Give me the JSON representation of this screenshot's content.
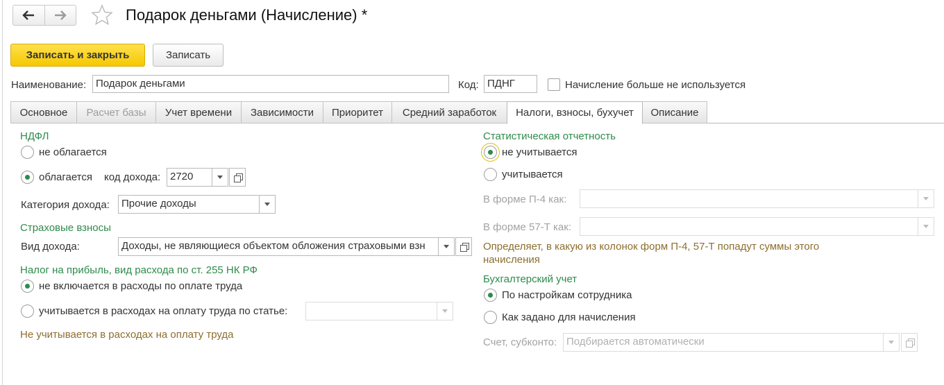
{
  "window": {
    "title": "Подарок деньгами (Начисление) *",
    "back_icon": "arrow-left-icon",
    "forward_icon": "arrow-right-icon",
    "favorite_icon": "star-icon"
  },
  "toolbar": {
    "save_close_label": "Записать и закрыть",
    "save_label": "Записать"
  },
  "header": {
    "name_label": "Наименование:",
    "name_value": "Подарок деньгами",
    "code_label": "Код:",
    "code_value": "ПДНГ",
    "unused_label": "Начисление больше не используется",
    "unused_checked": false
  },
  "tabs": [
    {
      "label": "Основное",
      "disabled": false
    },
    {
      "label": "Расчет базы",
      "disabled": true
    },
    {
      "label": "Учет времени",
      "disabled": false
    },
    {
      "label": "Зависимости",
      "disabled": false
    },
    {
      "label": "Приоритет",
      "disabled": false
    },
    {
      "label": "Средний заработок",
      "disabled": false
    },
    {
      "label": "Налоги, взносы, бухучет",
      "active": true
    },
    {
      "label": "Описание",
      "disabled": false
    }
  ],
  "ndfl": {
    "title": "НДФЛ",
    "not_taxed_label": "не облагается",
    "taxed_label": "облагается",
    "selected": "taxed",
    "income_code_label": "код дохода:",
    "income_code_value": "2720",
    "category_label": "Категория дохода:",
    "category_value": "Прочие доходы"
  },
  "insurance": {
    "title": "Страховые взносы",
    "income_type_label": "Вид дохода:",
    "income_type_value": "Доходы, не являющиеся объектом обложения страховыми взн"
  },
  "profit_tax": {
    "title": "Налог на прибыль, вид расхода по ст. 255 НК РФ",
    "not_included_label": "не включается в расходы по оплате труда",
    "included_label": "учитывается в расходах на оплату труда по статье:",
    "selected": "not_included",
    "article_value": "",
    "note": "Не учитывается в расходах на оплату труда"
  },
  "statistics": {
    "title": "Статистическая отчетность",
    "not_counted_label": "не учитывается",
    "counted_label": "учитывается",
    "selected": "not_counted",
    "p4_label": "В форме П-4 как:",
    "p4_value": "",
    "t57_label": "В форме 57-Т как:",
    "t57_value": "",
    "note": "Определяет, в какую из колонок форм П-4, 57-Т попадут суммы этого начисления"
  },
  "accounting": {
    "title": "Бухгалтерский учет",
    "by_employee_label": "По настройкам сотрудника",
    "by_accrual_label": "Как задано для начисления",
    "selected": "by_employee",
    "account_label": "Счет, субконто:",
    "account_placeholder": "Подбирается автоматически"
  },
  "colors": {
    "accent_green": "#2e8b4b",
    "primary_button": "#f5c800",
    "note_brown": "#8d6e2f"
  }
}
